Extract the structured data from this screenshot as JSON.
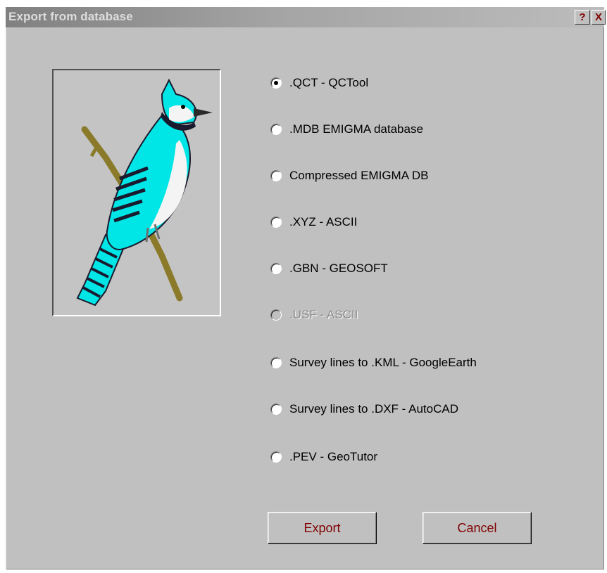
{
  "window": {
    "title": "Export from database",
    "help_label": "?",
    "close_label": "X"
  },
  "formats": {
    "items": [
      {
        "label": ".QCT - QCTool",
        "checked": true,
        "enabled": true
      },
      {
        "label": ".MDB EMIGMA database",
        "checked": false,
        "enabled": true
      },
      {
        "label": "Compressed EMIGMA DB",
        "checked": false,
        "enabled": true
      },
      {
        "label": ".XYZ - ASCII",
        "checked": false,
        "enabled": true
      },
      {
        "label": ".GBN - GEOSOFT",
        "checked": false,
        "enabled": true
      },
      {
        "label": ".USF - ASCII",
        "checked": false,
        "enabled": false
      },
      {
        "label": "Survey lines to .KML - GoogleEarth",
        "checked": false,
        "enabled": true
      },
      {
        "label": "Survey lines to .DXF - AutoCAD",
        "checked": false,
        "enabled": true
      },
      {
        "label": ".PEV - GeoTutor",
        "checked": false,
        "enabled": true
      }
    ]
  },
  "buttons": {
    "export_label": "Export",
    "cancel_label": "Cancel"
  },
  "illustration": {
    "icon": "blue-jay-bird-illustration",
    "colors": {
      "body": "#00e6e6",
      "stripes": "#1a1a2e",
      "branch": "#8a7a2a"
    }
  }
}
